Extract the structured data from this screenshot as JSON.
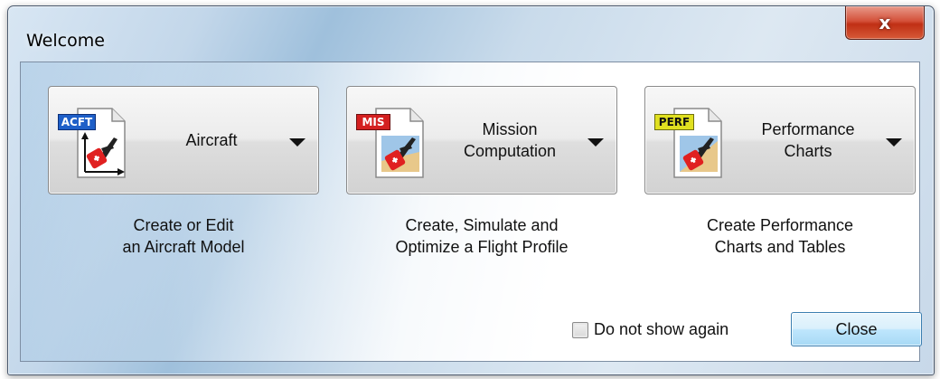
{
  "window": {
    "title": "Welcome",
    "close_glyph": "x"
  },
  "cards": [
    {
      "id": "aircraft",
      "label": "Aircraft",
      "badge": "ACFT",
      "badge_color": "#1e5fc8",
      "icon": "aircraft-document-icon",
      "description": "Create or Edit\nan Aircraft Model"
    },
    {
      "id": "mission",
      "label": "Mission\nComputation",
      "badge": "MIS",
      "badge_color": "#d42020",
      "icon": "mission-document-icon",
      "description": "Create, Simulate and\nOptimize a Flight Profile"
    },
    {
      "id": "performance",
      "label": "Performance\nCharts",
      "badge": "PERF",
      "badge_color": "#e0e020",
      "icon": "performance-document-icon",
      "description": "Create Performance\nCharts and Tables"
    }
  ],
  "footer": {
    "checkbox_label": "Do not show again",
    "checkbox_checked": false,
    "close_label": "Close"
  }
}
